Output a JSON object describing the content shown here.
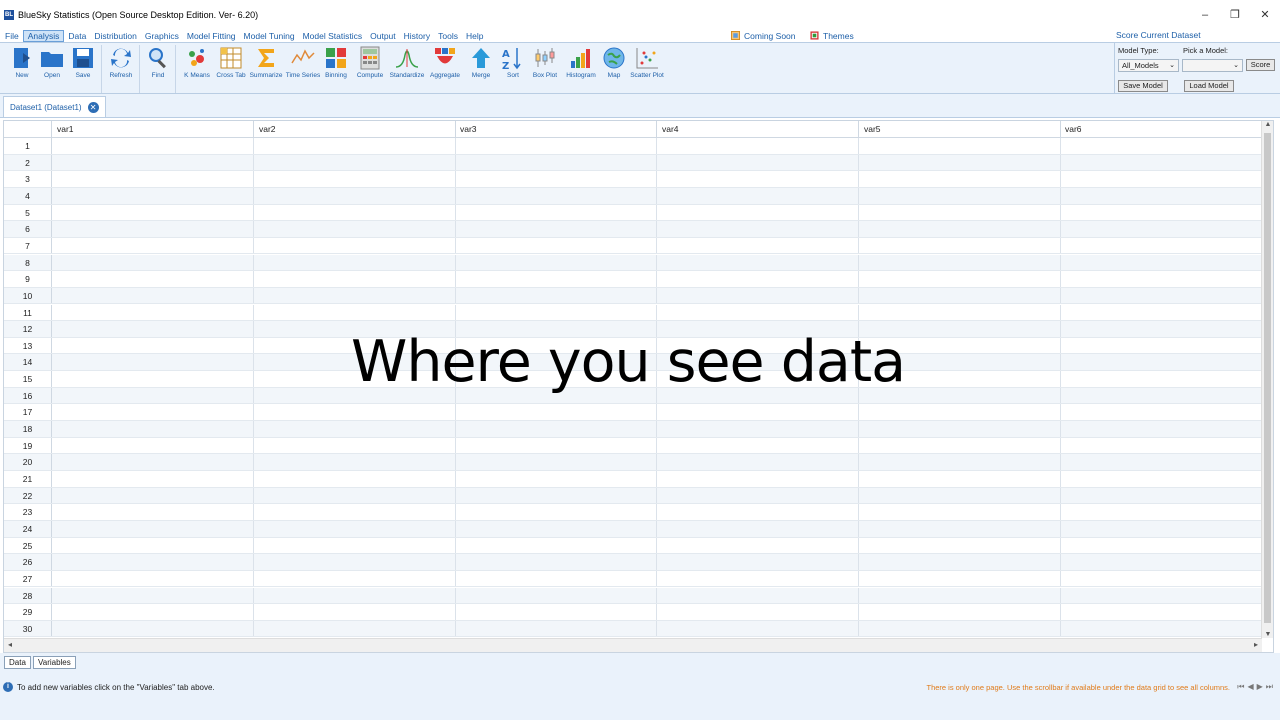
{
  "window": {
    "title": "BlueSky Statistics (Open Source Desktop Edition. Ver- 6.20)",
    "app_icon_text": "BL",
    "controls": [
      "–",
      "❐",
      "✕"
    ]
  },
  "menu": {
    "items": [
      "File",
      "Analysis",
      "Data",
      "Distribution",
      "Graphics",
      "Model Fitting",
      "Model Tuning",
      "Model Statistics",
      "Output",
      "History",
      "Tools",
      "Help"
    ],
    "active": "Analysis",
    "coming_soon": "Coming Soon",
    "themes": "Themes",
    "score_current_dataset": "Score Current Dataset"
  },
  "toolbar": {
    "buttons": [
      {
        "label": "New",
        "icon": "new-file-icon"
      },
      {
        "label": "Open",
        "icon": "open-folder-icon"
      },
      {
        "label": "Save",
        "icon": "save-disk-icon"
      },
      {
        "label": "Refresh",
        "icon": "refresh-icon"
      },
      {
        "label": "Find",
        "icon": "find-magnifier-icon"
      },
      {
        "label": "K Means",
        "icon": "kmeans-icon"
      },
      {
        "label": "Cross Tab",
        "icon": "crosstab-icon"
      },
      {
        "label": "Summarize",
        "icon": "sigma-icon"
      },
      {
        "label": "Time Series",
        "icon": "timeseries-icon"
      },
      {
        "label": "Binning",
        "icon": "binning-icon"
      },
      {
        "label": "Compute",
        "icon": "compute-icon"
      },
      {
        "label": "Standardize",
        "icon": "bell-curve-icon"
      },
      {
        "label": "Aggregate",
        "icon": "aggregate-icon"
      },
      {
        "label": "Merge",
        "icon": "merge-icon"
      },
      {
        "label": "Sort",
        "icon": "sort-az-icon"
      },
      {
        "label": "Box Plot",
        "icon": "boxplot-icon"
      },
      {
        "label": "Histogram",
        "icon": "histogram-icon"
      },
      {
        "label": "Map",
        "icon": "globe-icon"
      },
      {
        "label": "Scatter Plot",
        "icon": "scatter-icon"
      }
    ]
  },
  "model_panel": {
    "model_type_label": "Model Type:",
    "pick_model_label": "Pick a Model:",
    "model_type_value": "All_Models",
    "pick_model_value": "",
    "score_button": "Score",
    "save_model_button": "Save Model",
    "load_model_button": "Load Model"
  },
  "tabs": {
    "dataset_tab": "Dataset1 (Dataset1)"
  },
  "grid": {
    "columns": [
      "var1",
      "var2",
      "var3",
      "var4",
      "var5",
      "var6"
    ],
    "rows": [
      "1",
      "2",
      "3",
      "4",
      "5",
      "6",
      "7",
      "8",
      "9",
      "10",
      "11",
      "12",
      "13",
      "14",
      "15",
      "16",
      "17",
      "18",
      "19",
      "20",
      "21",
      "22",
      "23",
      "24",
      "25",
      "26",
      "27",
      "28",
      "29",
      "30"
    ]
  },
  "overlay_caption": "Where you see data",
  "bottom_tabs": [
    "Data",
    "Variables"
  ],
  "status": {
    "info": "To add new variables click on the \"Variables\" tab above.",
    "pages_note": "There is only one page. Use the scrollbar if available under the data grid to see all columns."
  },
  "colors": {
    "accent_blue": "#1d5fa8",
    "panel_bg": "#eaf2fb",
    "note_orange": "#e07b1a"
  }
}
